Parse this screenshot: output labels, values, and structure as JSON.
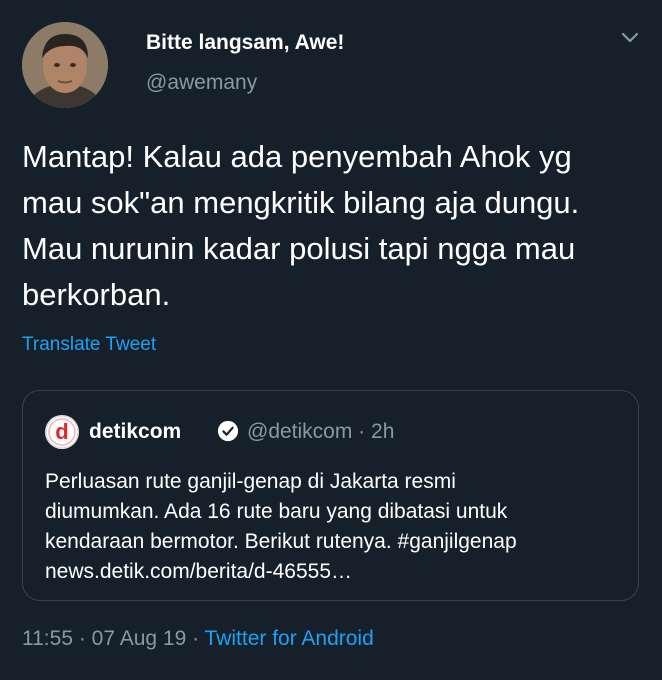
{
  "author": {
    "display_name": "Bitte langsam, Awe!",
    "handle": "@awemany"
  },
  "tweet": {
    "text": "Mantap! Kalau ada penyembah Ahok yg\nmau sok\"an mengkritik bilang aja dungu.\nMau nurunin kadar polusi tapi ngga mau\nberkorban.",
    "translate_label": "Translate Tweet"
  },
  "quoted_tweet": {
    "name": "detikcom",
    "handle_time": "@detikcom · 2h",
    "text": "Perluasan rute ganjil-genap di Jakarta resmi\ndiumumkan. Ada 16 rute baru yang dibatasi untuk\nkendaraan bermotor. Berikut rutenya. #ganjilgenap\nnews.detik.com/berita/d-46555…"
  },
  "footer": {
    "time_date": "11:55 · 07 Aug 19 · ",
    "client": "Twitter for Android"
  },
  "icons": {
    "chevron": "chevron-down-icon",
    "verified": "verified-badge-icon",
    "logo": "detikcom-logo-icon"
  },
  "colors": {
    "background": "#15202b",
    "link": "#1da1f2",
    "secondary_text": "#8899a6",
    "border": "#38444d",
    "logo_red": "#e4232b"
  }
}
